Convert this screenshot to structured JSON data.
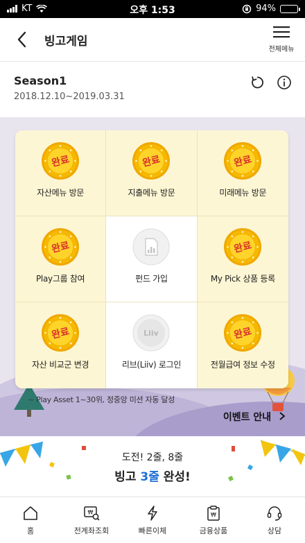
{
  "status_bar": {
    "carrier": "KT",
    "time": "오후 1:53",
    "battery": "94%",
    "battery_level": 0.94
  },
  "header": {
    "title": "빙고게임",
    "menu_label": "전체메뉴"
  },
  "season": {
    "name": "Season1",
    "period": "2018.12.10~2019.03.31"
  },
  "badge_text": "완료",
  "bingo": [
    {
      "label": "자산메뉴 방문",
      "status": "done",
      "icon": "completed-coin-icon"
    },
    {
      "label": "지출메뉴 방문",
      "status": "done",
      "icon": "completed-coin-icon"
    },
    {
      "label": "미래메뉴 방문",
      "status": "done",
      "icon": "completed-coin-icon"
    },
    {
      "label": "Play그룹 참여",
      "status": "done",
      "icon": "completed-coin-icon"
    },
    {
      "label": "펀드 가입",
      "status": "todo",
      "icon": "document-chart-icon"
    },
    {
      "label": "My Pick 상품 등록",
      "status": "done",
      "icon": "completed-coin-icon"
    },
    {
      "label": "자산 비교군 변경",
      "status": "done",
      "icon": "completed-coin-icon"
    },
    {
      "label": "리브(Liiv) 로그인",
      "status": "todo",
      "icon": "liiv-logo-icon",
      "icon_text": "Liiv"
    },
    {
      "label": "전월급여 정보 수정",
      "status": "done",
      "icon": "completed-coin-icon"
    }
  ],
  "mission_note": "~ Play Asset 1~30위, 정중앙 미션 자동 달성",
  "event_link": "이벤트 안내",
  "progress": {
    "subtitle": "도전! 2줄, 8줄",
    "main_pre": "빙고 ",
    "main_highlight": "3줄",
    "main_post": " 완성!"
  },
  "tabbar": [
    {
      "label": "홈",
      "icon": "home-icon"
    },
    {
      "label": "전계좌조회",
      "icon": "account-search-icon"
    },
    {
      "label": "빠른이체",
      "icon": "quick-transfer-icon"
    },
    {
      "label": "금융상품",
      "icon": "financial-product-icon"
    },
    {
      "label": "상담",
      "icon": "consult-headset-icon"
    }
  ],
  "colors": {
    "done_cell": "#fdf6d4",
    "coin": "#f7b900",
    "coin_text": "#d8322a",
    "highlight": "#1f6fd6"
  }
}
